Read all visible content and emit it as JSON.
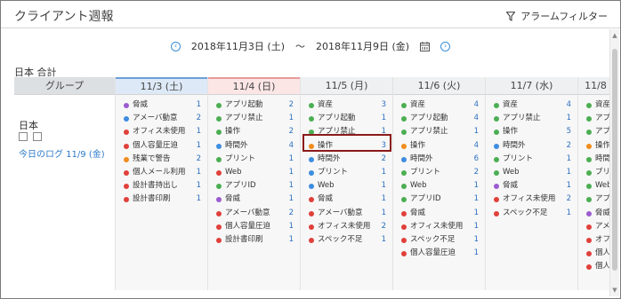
{
  "app_title": "クライアント週報",
  "alarm_filter_label": "アラームフィルター",
  "date_range": {
    "start": "2018年11月3日 (土)",
    "separator": "〜",
    "end": "2018年11月9日 (金)"
  },
  "summary_label": "日本 合計",
  "group": {
    "header": "グループ",
    "country": "日本",
    "today_log_link": "今日のログ 11/9 (金)"
  },
  "colors": {
    "purple": "#9b5bd0",
    "blue": "#3e8de0",
    "red": "#e0403a",
    "green": "#4cae52",
    "orange": "#f08c1c"
  },
  "days": [
    {
      "header": "11/3 (土)",
      "items": [
        {
          "color": "purple",
          "label": "脅威",
          "count": "1"
        },
        {
          "color": "blue",
          "label": "アメーバ動意",
          "count": "2"
        },
        {
          "color": "red",
          "label": "オフィス未使用",
          "count": "1"
        },
        {
          "color": "red",
          "label": "個人容量圧迫",
          "count": "1"
        },
        {
          "color": "orange",
          "label": "残業で警告",
          "count": "2"
        },
        {
          "color": "red",
          "label": "個人メール利用",
          "count": "1"
        },
        {
          "color": "red",
          "label": "設計書持出し",
          "count": "1"
        },
        {
          "color": "red",
          "label": "設計書印刷",
          "count": "1"
        }
      ]
    },
    {
      "header": "11/4 (日)",
      "items": [
        {
          "color": "green",
          "label": "アプリ起動",
          "count": "2"
        },
        {
          "color": "green",
          "label": "アプリ禁止",
          "count": "1"
        },
        {
          "color": "green",
          "label": "操作",
          "count": "2"
        },
        {
          "color": "blue",
          "label": "時間外",
          "count": "4"
        },
        {
          "color": "green",
          "label": "プリント",
          "count": "1"
        },
        {
          "color": "red",
          "label": "Web",
          "count": "1"
        },
        {
          "color": "green",
          "label": "アプリID",
          "count": "1"
        },
        {
          "color": "purple",
          "label": "脅威",
          "count": "1"
        },
        {
          "color": "red",
          "label": "アメーバ動意",
          "count": "2"
        },
        {
          "color": "red",
          "label": "個人容量圧迫",
          "count": "1"
        },
        {
          "color": "red",
          "label": "設計書印刷",
          "count": "1"
        }
      ]
    },
    {
      "header": "11/5 (月)",
      "items": [
        {
          "color": "green",
          "label": "資産",
          "count": "3"
        },
        {
          "color": "green",
          "label": "アプリ起動",
          "count": "1"
        },
        {
          "color": "green",
          "label": "アプリ禁止",
          "count": "1"
        },
        {
          "color": "orange",
          "label": "操作",
          "count": "3"
        },
        {
          "color": "blue",
          "label": "時間外",
          "count": "2"
        },
        {
          "color": "blue",
          "label": "プリント",
          "count": "1"
        },
        {
          "color": "blue",
          "label": "Web",
          "count": "1"
        },
        {
          "color": "red",
          "label": "脅威",
          "count": "1"
        },
        {
          "color": "red",
          "label": "アメーバ動意",
          "count": "1"
        },
        {
          "color": "red",
          "label": "オフィス未使用",
          "count": "2"
        },
        {
          "color": "red",
          "label": "スペック不足",
          "count": "1"
        }
      ]
    },
    {
      "header": "11/6 (火)",
      "items": [
        {
          "color": "green",
          "label": "資産",
          "count": "4"
        },
        {
          "color": "green",
          "label": "アプリ起動",
          "count": "4"
        },
        {
          "color": "green",
          "label": "アプリ禁止",
          "count": "1"
        },
        {
          "color": "orange",
          "label": "操作",
          "count": "4"
        },
        {
          "color": "blue",
          "label": "時間外",
          "count": "6"
        },
        {
          "color": "green",
          "label": "プリント",
          "count": "2"
        },
        {
          "color": "green",
          "label": "Web",
          "count": "1"
        },
        {
          "color": "green",
          "label": "アプリID",
          "count": "1"
        },
        {
          "color": "red",
          "label": "脅威",
          "count": "1"
        },
        {
          "color": "red",
          "label": "オフィス未使用",
          "count": "1"
        },
        {
          "color": "red",
          "label": "スペック不足",
          "count": "1"
        },
        {
          "color": "red",
          "label": "個人容量圧迫",
          "count": "1"
        }
      ]
    },
    {
      "header": "11/7 (水)",
      "items": [
        {
          "color": "green",
          "label": "資産",
          "count": "4"
        },
        {
          "color": "green",
          "label": "アプリ禁止",
          "count": "1"
        },
        {
          "color": "green",
          "label": "操作",
          "count": "5"
        },
        {
          "color": "blue",
          "label": "時間外",
          "count": "2"
        },
        {
          "color": "green",
          "label": "プリント",
          "count": "1"
        },
        {
          "color": "green",
          "label": "Web",
          "count": "1"
        },
        {
          "color": "purple",
          "label": "脅威",
          "count": "1"
        },
        {
          "color": "red",
          "label": "オフィス未使用",
          "count": "2"
        },
        {
          "color": "red",
          "label": "スペック不足",
          "count": "1"
        }
      ]
    },
    {
      "header": "11/8",
      "items": [
        {
          "color": "green",
          "label": "資産",
          "count": ""
        },
        {
          "color": "green",
          "label": "アプリ",
          "count": ""
        },
        {
          "color": "green",
          "label": "アプリ",
          "count": ""
        },
        {
          "color": "orange",
          "label": "操作",
          "count": ""
        },
        {
          "color": "green",
          "label": "時間外",
          "count": ""
        },
        {
          "color": "green",
          "label": "プリント",
          "count": ""
        },
        {
          "color": "green",
          "label": "Web",
          "count": ""
        },
        {
          "color": "green",
          "label": "アプリ",
          "count": ""
        },
        {
          "color": "purple",
          "label": "脅威",
          "count": ""
        },
        {
          "color": "red",
          "label": "アメ",
          "count": ""
        },
        {
          "color": "red",
          "label": "オフ",
          "count": ""
        },
        {
          "color": "red",
          "label": "個人",
          "count": ""
        },
        {
          "color": "red",
          "label": "個人",
          "count": ""
        }
      ]
    }
  ]
}
